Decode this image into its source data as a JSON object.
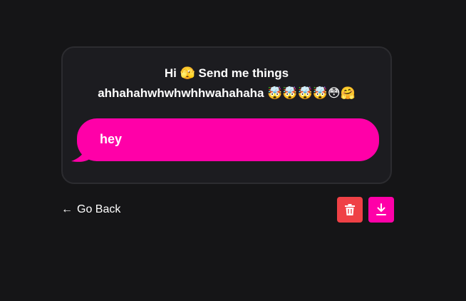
{
  "card": {
    "prompt_line1": "Hi 🫣 Send me things",
    "prompt_line2": "ahhahahwhwhwhhwahahaha 🤯🤯🤯🤯😳🤗"
  },
  "message": {
    "text": "hey"
  },
  "footer": {
    "back_arrow": "←",
    "back_label": "Go Back"
  },
  "actions": {
    "delete_icon": "trash-icon",
    "download_icon": "download-icon"
  },
  "colors": {
    "background": "#151517",
    "card": "#1c1c20",
    "accent": "#ff00a8",
    "danger": "#ef4146"
  }
}
